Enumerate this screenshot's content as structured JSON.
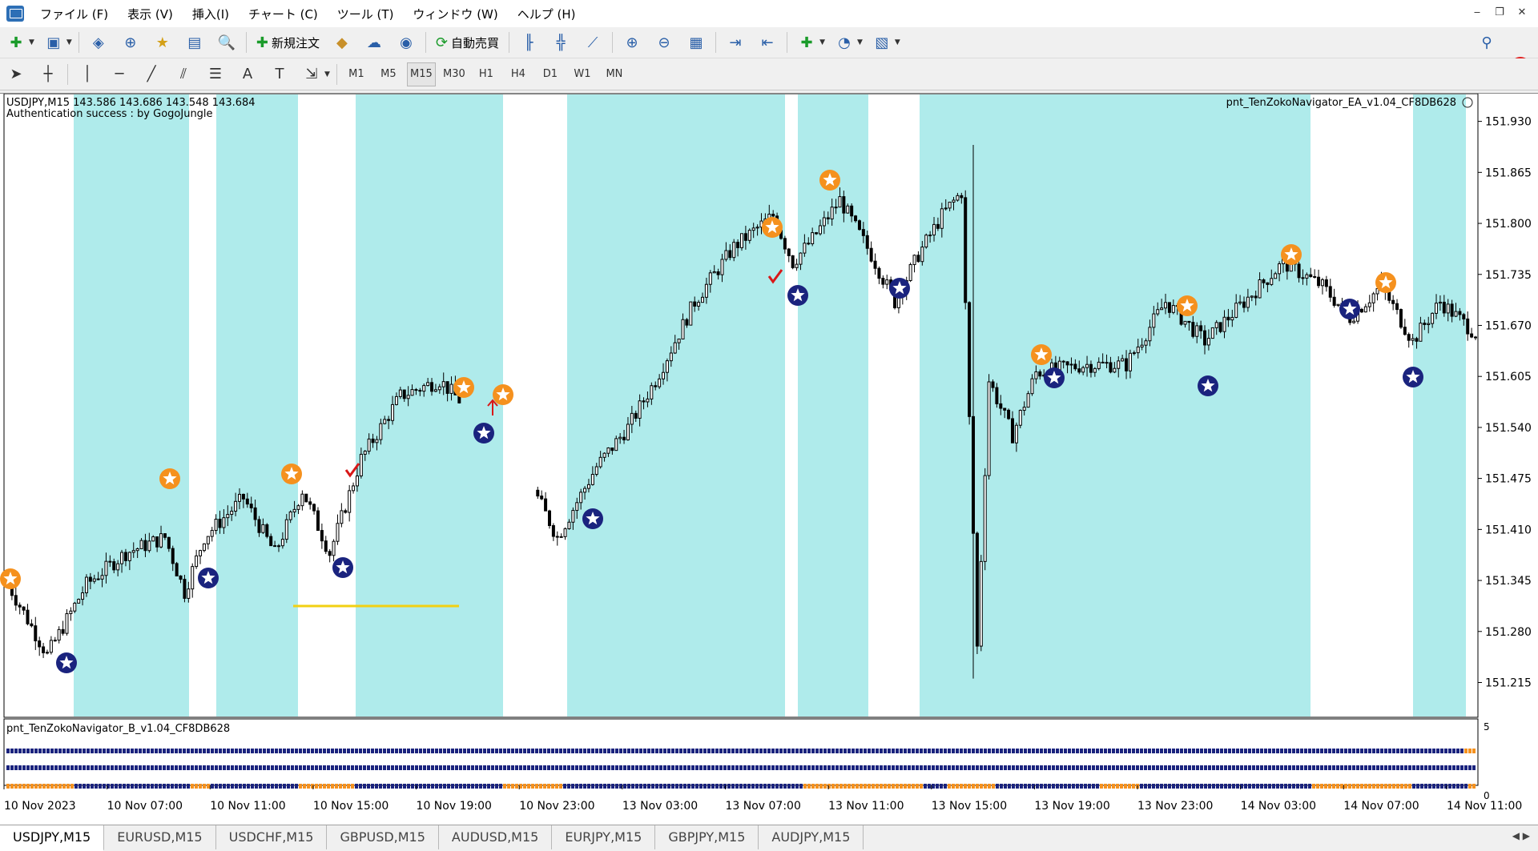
{
  "menu": [
    "ファイル (F)",
    "表示 (V)",
    "挿入(I)",
    "チャート (C)",
    "ツール (T)",
    "ウィンドウ (W)",
    "ヘルプ (H)"
  ],
  "toolbar": {
    "new_order_label": "新規注文",
    "auto_trade_label": "自動売買",
    "notification_count": "1",
    "timeframes": [
      "M1",
      "M5",
      "M15",
      "M30",
      "H1",
      "H4",
      "D1",
      "W1",
      "MN"
    ],
    "active_timeframe": "M15"
  },
  "chart": {
    "symbol_info": "USDJPY,M15  143.586 143.686 143.548 143.684",
    "auth_message": "Authentication success : by GogoJungle",
    "ea_label": "pnt_TenZokoNavigator_EA_v1.04_CF8DB628",
    "indicator_label": "pnt_TenZokoNavigator_B_v1.04_CF8DB628",
    "indicator_scale_top": "5",
    "indicator_scale_bottom": "0"
  },
  "chart_data": {
    "type": "candlestick",
    "symbol": "USDJPY",
    "timeframe": "M15",
    "price_ticks": [
      "151.930",
      "151.865",
      "151.800",
      "151.735",
      "151.670",
      "151.605",
      "151.540",
      "151.475",
      "151.410",
      "151.345",
      "151.280",
      "151.215"
    ],
    "y_range": [
      151.19,
      151.95
    ],
    "time_ticks": [
      "10 Nov 2023",
      "10 Nov 07:00",
      "10 Nov 11:00",
      "10 Nov 15:00",
      "10 Nov 19:00",
      "10 Nov 23:00",
      "13 Nov 03:00",
      "13 Nov 07:00",
      "13 Nov 11:00",
      "13 Nov 15:00",
      "13 Nov 19:00",
      "13 Nov 23:00",
      "14 Nov 03:00",
      "14 Nov 07:00",
      "14 Nov 11:00"
    ],
    "highlight_color": "#afebeb",
    "accent_orange": "#f5911e",
    "accent_navy": "#1a237e"
  },
  "tabs": [
    "USDJPY,M15",
    "EURUSD,M15",
    "USDCHF,M15",
    "GBPUSD,M15",
    "AUDUSD,M15",
    "EURJPY,M15",
    "GBPJPY,M15",
    "AUDJPY,M15"
  ],
  "active_tab": "USDJPY,M15"
}
